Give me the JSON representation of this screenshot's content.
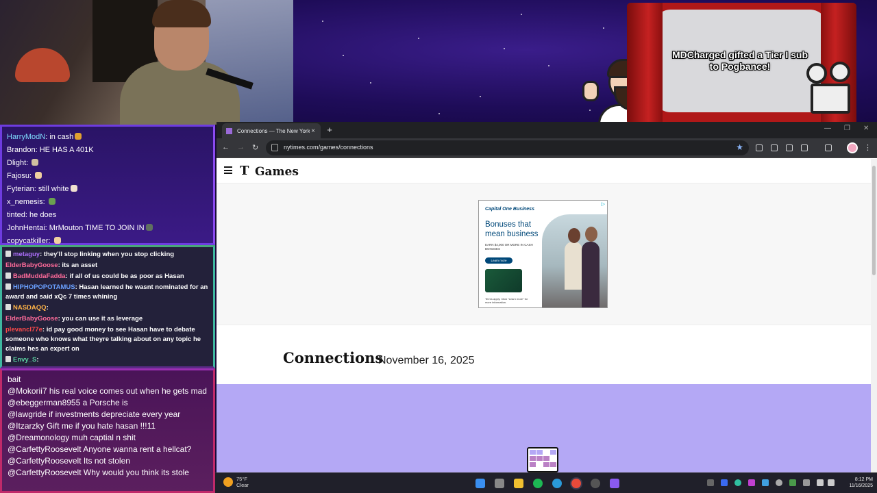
{
  "overlay": {
    "sub_alert": "MDCharged gifted a Tier I sub to Pogbance!"
  },
  "chat_top": [
    {
      "user": "HarryModN",
      "color": "#7fdcff",
      "text": "in cash",
      "emote": "#e0a030"
    },
    {
      "user": "Brandon",
      "color": "#ffffff",
      "text": "HE HAS A 401K",
      "emote": ""
    },
    {
      "user": "Dlight",
      "color": "#ffffff",
      "text": "",
      "emote": "#d0c0a0"
    },
    {
      "user": "Fajosu",
      "color": "#ffffff",
      "text": "",
      "emote": "#f0d0a0"
    },
    {
      "user": "Fyterian",
      "color": "#ffffff",
      "text": "still white",
      "emote": "#f0e0d0"
    },
    {
      "user": "x_nemesis",
      "color": "#ffffff",
      "text": "",
      "emote": "#6aa050"
    },
    {
      "user": "tinted",
      "color": "#ffffff",
      "text": "he does",
      "emote": ""
    },
    {
      "user": "JohnHentai",
      "color": "#ffffff",
      "text": "MrMouton TIME TO JOIN IN",
      "emote": "#607060"
    },
    {
      "user": "copycatkiller",
      "color": "#ffffff",
      "text": "",
      "emote": "#f0d0a0"
    }
  ],
  "chat_mid": [
    {
      "user": "metaguy",
      "color": "#b070ff",
      "text": "they'll stop linking when you stop clicking",
      "badge": true
    },
    {
      "user": "ElderBabyGoose",
      "color": "#ff6b9a",
      "text": "its an asset",
      "badge": false
    },
    {
      "user": "BadMuddaFadda",
      "color": "#ff6b9a",
      "text": "if all of us could be as poor as Hasan",
      "badge": true
    },
    {
      "user": "HIPHOPOPOTAMUS",
      "color": "#6aa0ff",
      "text": "Hasan learned he wasnt nominated for an award and said xQc 7 times whining",
      "badge": true
    },
    {
      "user": "NASDAQQ",
      "color": "#ffb347",
      "text": "",
      "badge": true
    },
    {
      "user": "ElderBabyGoose",
      "color": "#ff6b9a",
      "text": "you can use it as leverage",
      "badge": false
    },
    {
      "user": "plevancl77e",
      "color": "#ff4a4a",
      "text": "id pay good money to see Hasan have to debate someone who knows what theyre talking about on any topic he claims hes an expert on",
      "badge": false
    },
    {
      "user": "Envy_S",
      "color": "#5ad0a0",
      "text": "",
      "badge": true
    }
  ],
  "chat_bottom": [
    "bait",
    "@Mokorii7 his real voice comes out when he gets mad",
    "@ebeggerman8955 a Porsche is",
    "@lawgride if investments depreciate every year",
    "@Itzarzky Gift me if you hate hasan !!!11",
    "@Dreamonology muh captial n shit",
    "@CarfettyRoosevelt Anyone wanna rent a hellcat?",
    "@CarfettyRoosevelt Its not stolen",
    "@CarfettyRoosevelt Why would you think its stole"
  ],
  "browser": {
    "tab_title": "Connections — The New York T",
    "tab_close": "×",
    "new_tab": "+",
    "url": "nytimes.com/games/connections",
    "win_minimize": "—",
    "win_maximize": "❐",
    "win_close": "✕",
    "back": "←",
    "forward": "→",
    "reload": "↻",
    "bookmark_star": "★",
    "menu": "⋮"
  },
  "nyt": {
    "logo_t": "T",
    "section": "Games",
    "ad": {
      "brand": "Capital One Business",
      "adchoice": "▷",
      "headline": "Bonuses that mean business",
      "fine": "EARN $4,000 OR MORE IN CASH BONUSES",
      "button": "Learn more",
      "terms": "Terms apply. Click \"Learn more\" for more information."
    },
    "game_title": "Connections",
    "game_date": "November 16, 2025"
  },
  "taskbar": {
    "temp": "75°F",
    "condition": "Clear",
    "time": "8:12 PM",
    "date": "11/16/2025"
  },
  "colors": {
    "nyt_purple": "#b4a8f5",
    "chrome_dark": "#202124",
    "capital_blue": "#004879"
  }
}
